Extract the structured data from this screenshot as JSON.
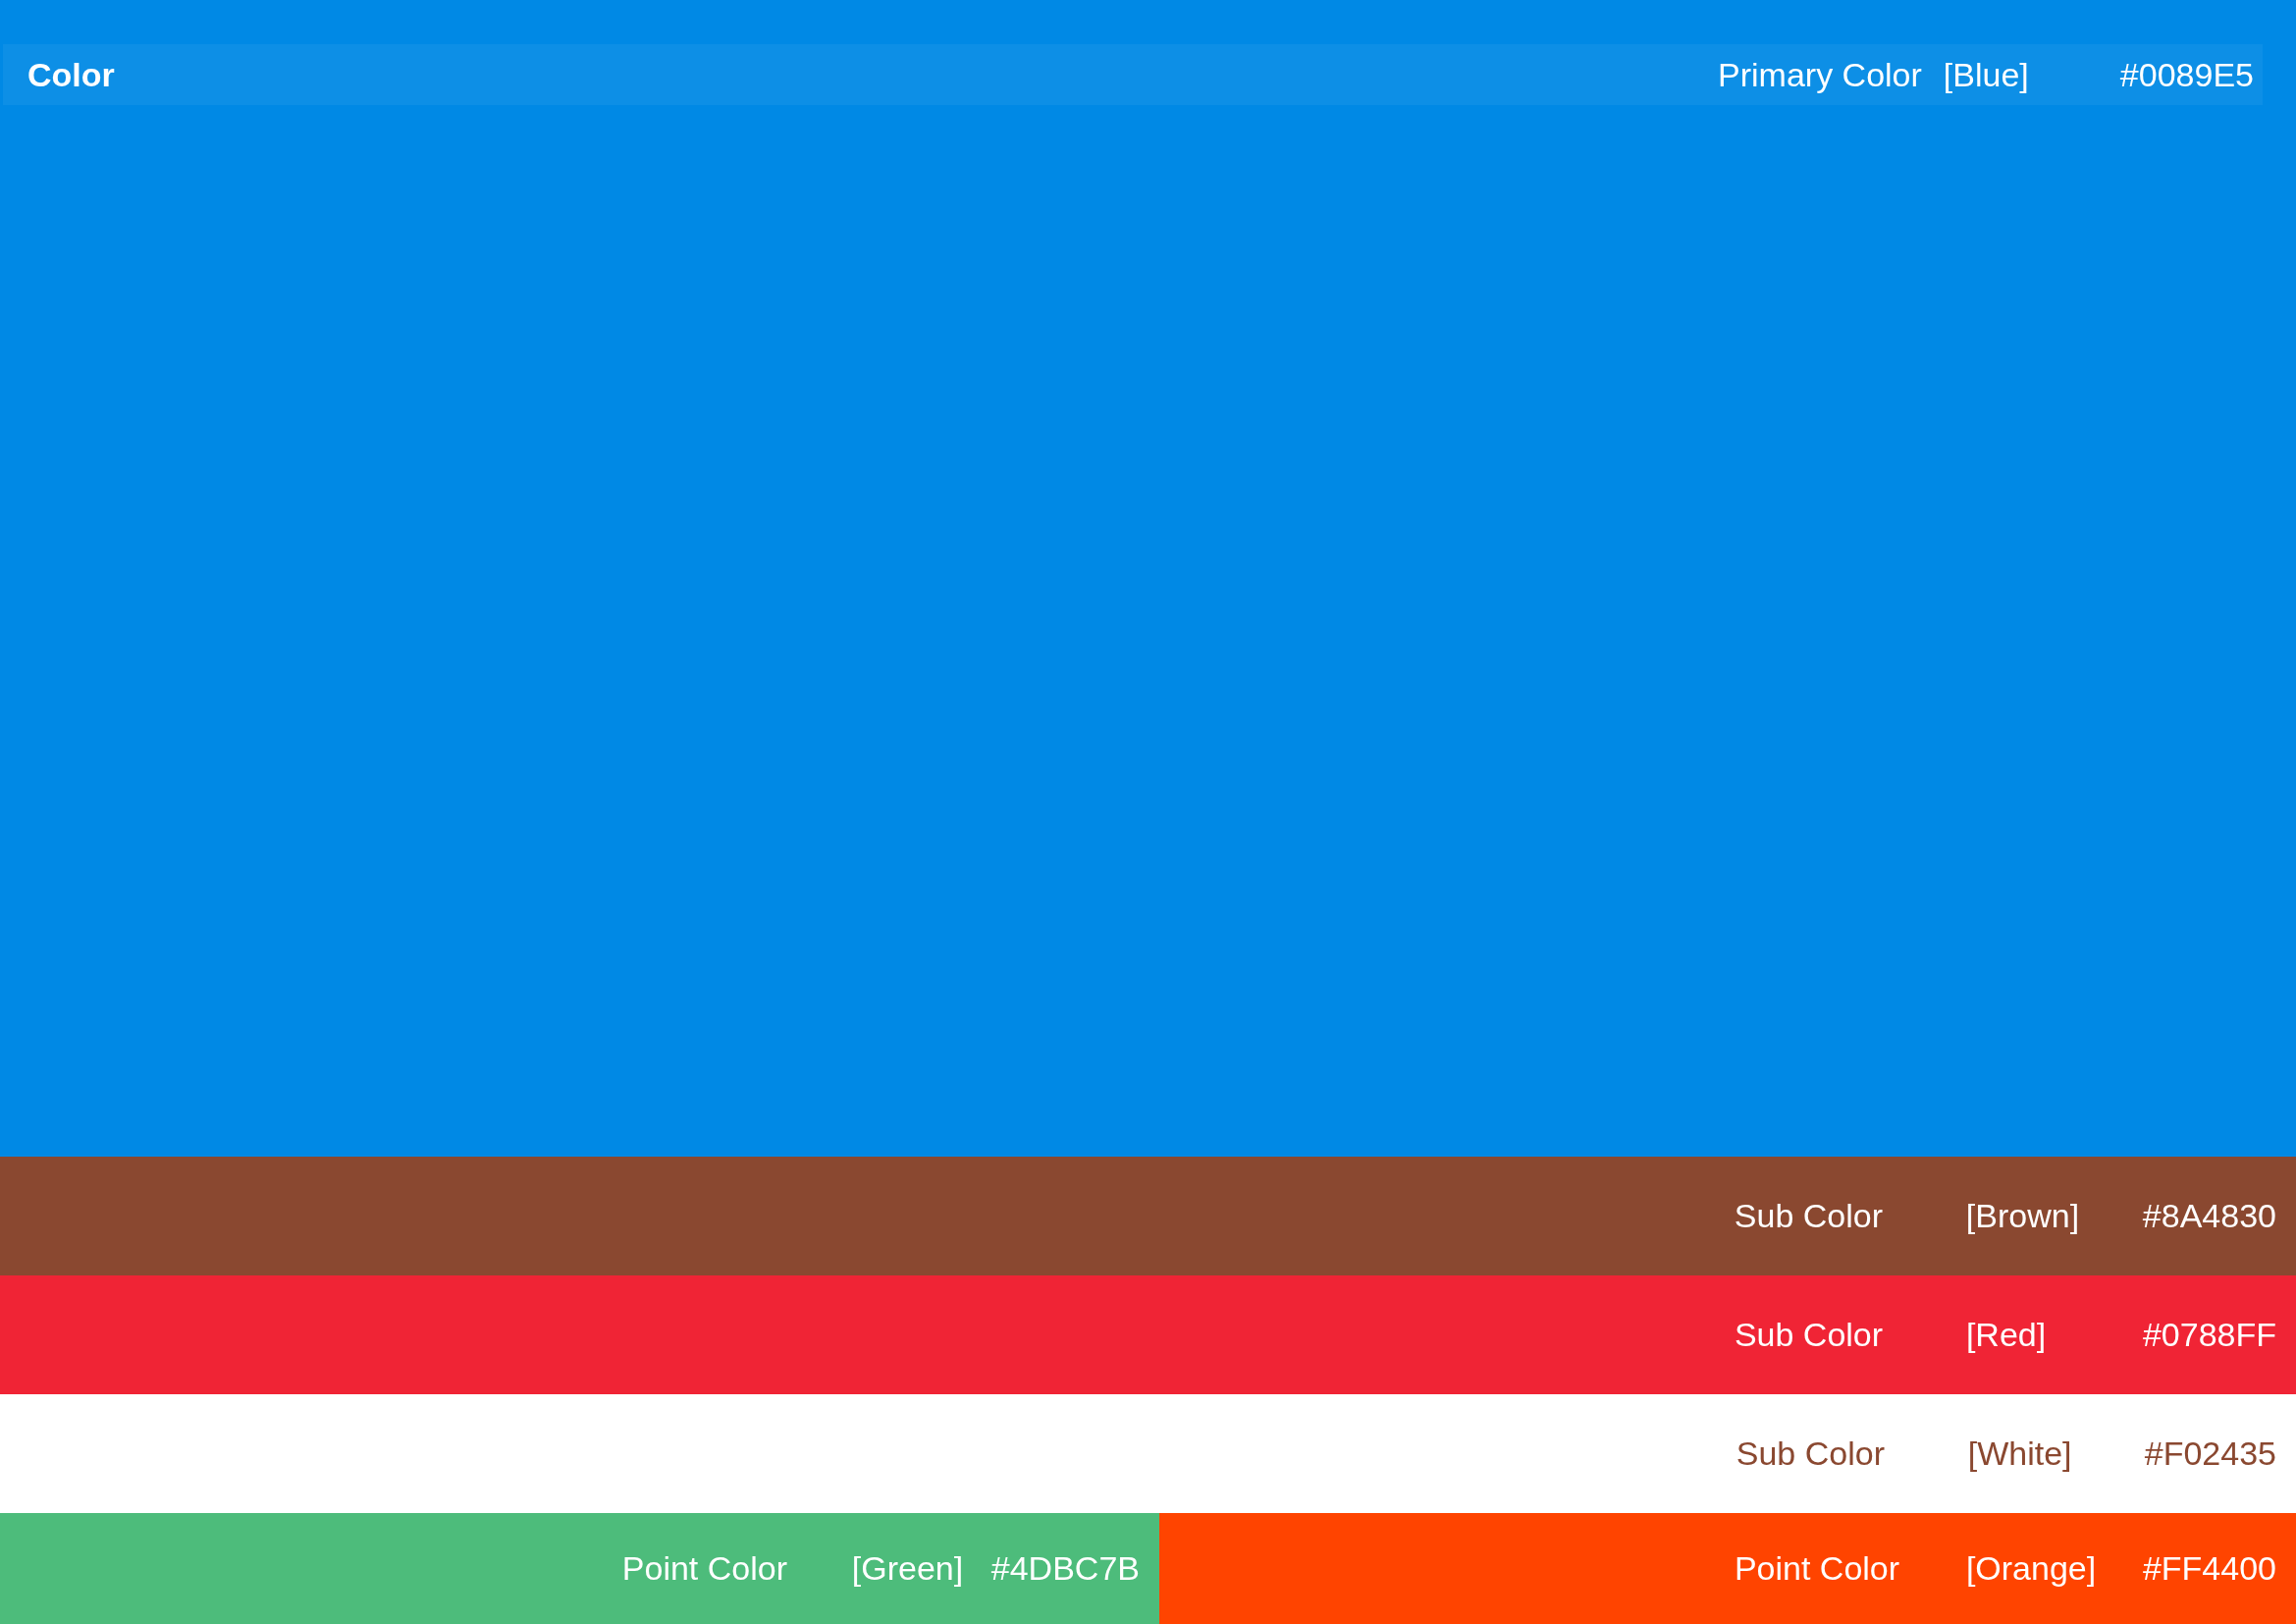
{
  "primary": {
    "title": "Color",
    "label": "Primary Color",
    "name": "[Blue]",
    "hex": "#0089E5",
    "color": "#0089e5"
  },
  "sub_colors": [
    {
      "label": "Sub Color",
      "name": "[Brown]",
      "hex": "#8A4830",
      "color": "#8a4830"
    },
    {
      "label": "Sub Color",
      "name": "[Red]",
      "hex": "#0788FF",
      "color": "#f02435"
    },
    {
      "label": "Sub Color",
      "name": "[White]",
      "hex": "#F02435",
      "color": "#ffffff"
    }
  ],
  "point_colors": [
    {
      "label": "Point Color",
      "name": "[Green]",
      "hex": "#4DBC7B",
      "color": "#4dbc7b"
    },
    {
      "label": "Point Color",
      "name": "[Orange]",
      "hex": "#FF4400",
      "color": "#ff4400"
    }
  ]
}
